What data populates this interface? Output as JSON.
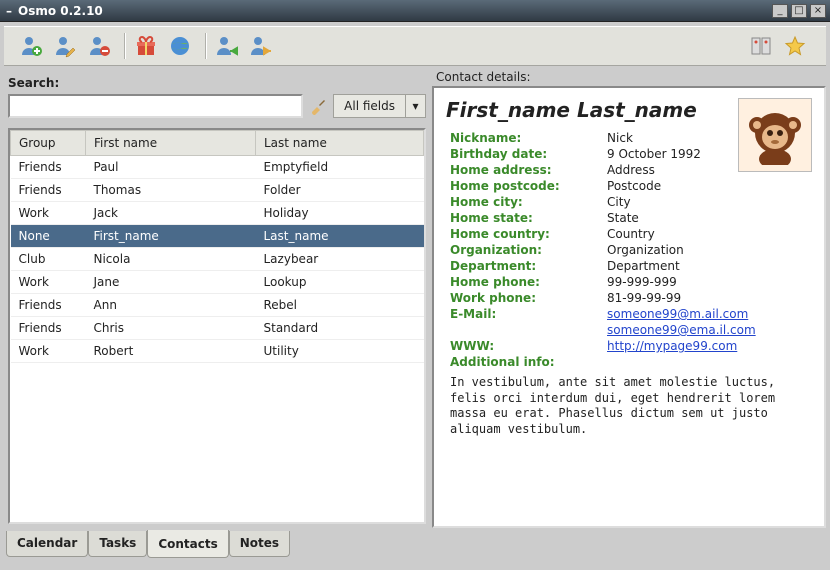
{
  "window": {
    "title": "Osmo 0.2.10"
  },
  "toolbar": {
    "icons": [
      "add-contact",
      "edit-contact",
      "remove-contact",
      "birthdays",
      "web",
      "import",
      "export",
      "map-view",
      "favorite"
    ]
  },
  "search": {
    "label": "Search:",
    "value": "",
    "placeholder": "",
    "filter_label": "All fields"
  },
  "columns": [
    "Group",
    "First name",
    "Last name"
  ],
  "contacts": [
    {
      "group": "Friends",
      "first": "Paul",
      "last": "Emptyfield",
      "selected": false
    },
    {
      "group": "Friends",
      "first": "Thomas",
      "last": "Folder",
      "selected": false
    },
    {
      "group": "Work",
      "first": "Jack",
      "last": "Holiday",
      "selected": false
    },
    {
      "group": "None",
      "first": "First_name",
      "last": "Last_name",
      "selected": true
    },
    {
      "group": "Club",
      "first": "Nicola",
      "last": "Lazybear",
      "selected": false
    },
    {
      "group": "Work",
      "first": "Jane",
      "last": "Lookup",
      "selected": false
    },
    {
      "group": "Friends",
      "first": "Ann",
      "last": "Rebel",
      "selected": false
    },
    {
      "group": "Friends",
      "first": "Chris",
      "last": "Standard",
      "selected": false
    },
    {
      "group": "Work",
      "first": "Robert",
      "last": "Utility",
      "selected": false
    }
  ],
  "details": {
    "panel_label": "Contact details:",
    "name": "First_name Last_name",
    "fields_order": [
      "nickname",
      "birthday",
      "home_address",
      "home_postcode",
      "home_city",
      "home_state",
      "home_country",
      "organization",
      "department",
      "home_phone",
      "work_phone",
      "email",
      "www",
      "additional"
    ],
    "nickname": {
      "label": "Nickname:",
      "value": "Nick"
    },
    "birthday": {
      "label": "Birthday date:",
      "value": "9 October 1992"
    },
    "home_address": {
      "label": "Home address:",
      "value": "Address"
    },
    "home_postcode": {
      "label": "Home postcode:",
      "value": "Postcode"
    },
    "home_city": {
      "label": "Home city:",
      "value": "City"
    },
    "home_state": {
      "label": "Home state:",
      "value": "State"
    },
    "home_country": {
      "label": "Home country:",
      "value": "Country"
    },
    "organization": {
      "label": "Organization:",
      "value": "Organization"
    },
    "department": {
      "label": "Department:",
      "value": "Department"
    },
    "home_phone": {
      "label": "Home phone:",
      "value": "99-999-999"
    },
    "work_phone": {
      "label": "Work phone:",
      "value": "81-99-99-99"
    },
    "email": {
      "label": "E-Mail:",
      "values": [
        "someone99@m.ail.com",
        "someone99@ema.il.com"
      ]
    },
    "www": {
      "label": "WWW:",
      "values": [
        "http://mypage99.com"
      ]
    },
    "additional": {
      "label": "Additional info:",
      "text": "In vestibulum, ante sit amet molestie luctus, felis orci interdum dui, eget hendrerit lorem massa eu erat. Phasellus dictum sem ut justo aliquam vestibulum."
    }
  },
  "tabs": [
    {
      "label": "Calendar",
      "active": false
    },
    {
      "label": "Tasks",
      "active": false
    },
    {
      "label": "Contacts",
      "active": true
    },
    {
      "label": "Notes",
      "active": false
    }
  ]
}
